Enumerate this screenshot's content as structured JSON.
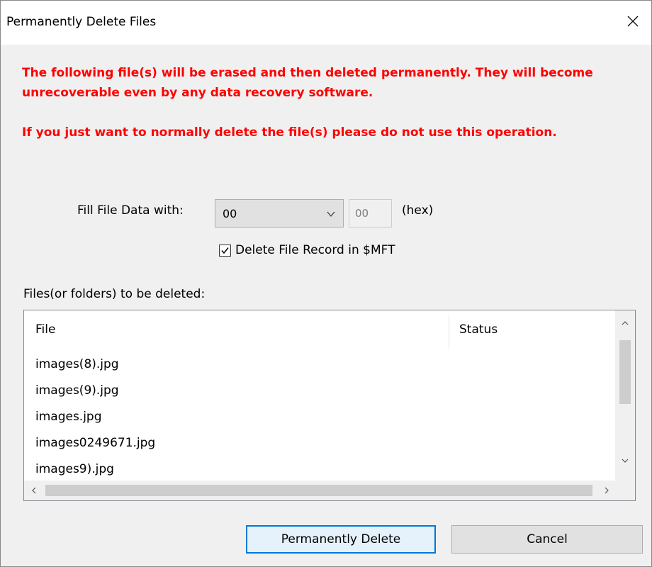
{
  "window": {
    "title": "Permanently Delete Files"
  },
  "warnings": {
    "line1": "The following file(s) will be erased and then deleted permanently. They will become unrecoverable even by any data recovery software.",
    "line2": "If you just want to normally delete the file(s) please do not use this operation."
  },
  "fill": {
    "label": "Fill File Data with:",
    "selected": "00",
    "hex_value": "00",
    "hex_suffix": "(hex)"
  },
  "delete_record": {
    "label": "Delete File Record in $MFT",
    "checked": true
  },
  "files": {
    "label": "Files(or folders) to be deleted:",
    "columns": [
      "File",
      "Status"
    ],
    "rows": [
      {
        "file": "images(8).jpg",
        "status": ""
      },
      {
        "file": "images(9).jpg",
        "status": ""
      },
      {
        "file": "images.jpg",
        "status": ""
      },
      {
        "file": "images0249671.jpg",
        "status": ""
      },
      {
        "file": "images9).jpg",
        "status": ""
      }
    ]
  },
  "buttons": {
    "primary": "Permanently Delete",
    "cancel": "Cancel"
  },
  "colors": {
    "warning": "#ff0000",
    "accent": "#0078d7"
  }
}
